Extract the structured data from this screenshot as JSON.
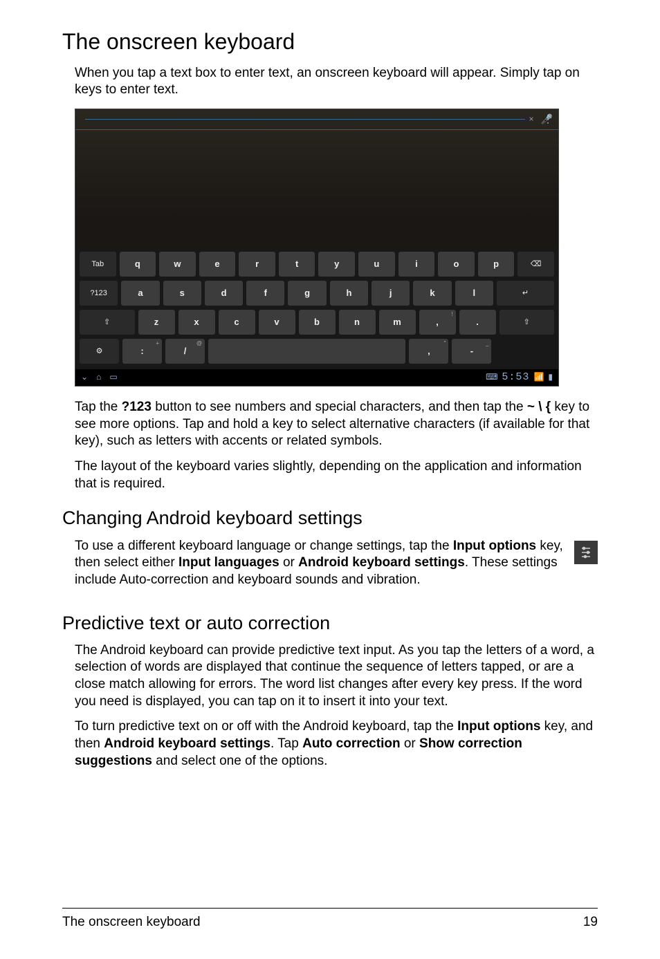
{
  "title": "The onscreen keyboard",
  "intro": "When you tap a text box to enter text, an onscreen keyboard will appear. Simply tap on keys to enter text.",
  "screenshot": {
    "searchbar": {
      "close": "×",
      "mic": "🎤",
      "menu": "⋮"
    },
    "keyboard": {
      "row1": {
        "left": "Tab",
        "keys": [
          "q",
          "w",
          "e",
          "r",
          "t",
          "y",
          "u",
          "i",
          "o",
          "p"
        ],
        "right_icon": "⌫"
      },
      "row2": {
        "left": "?123",
        "keys": [
          "a",
          "s",
          "d",
          "f",
          "g",
          "h",
          "j",
          "k",
          "l"
        ],
        "right_icon": "↵"
      },
      "row3": {
        "left_icon": "⇧",
        "keys": [
          "z",
          "x",
          "c",
          "v",
          "b",
          "n",
          "m",
          ",",
          "."
        ],
        "sup": {
          ",": "!",
          ".": "?"
        },
        "right_icon": "⇧"
      },
      "row4": {
        "settings_icon": "⚙",
        "k1": ":",
        "k1_sup": "+",
        "k2": "/",
        "k2_sup": "@",
        "k3": ",",
        "k3_sup": "\"",
        "k4": "-",
        "k4_sup": "_"
      }
    },
    "sysbar": {
      "back_icon": "⌄",
      "home_icon": "⌂",
      "recent_icon": "▭",
      "kb_icon": "⌨",
      "clock": "5:53",
      "wifi_icon": "📶",
      "batt_icon": "▮"
    }
  },
  "para2": {
    "pre": "Tap the ",
    "b1": "?123",
    "mid1": " button to see numbers and special characters, and then tap the ",
    "b2": "~ \\ {",
    "mid2": " key to see more options. Tap and hold a key to select alternative characters (if available for that key), such as letters with accents or related symbols."
  },
  "para3": "The layout of the keyboard varies slightly, depending on the application and information that is required.",
  "heading2": "Changing Android keyboard settings",
  "para4": {
    "pre": "To use a different keyboard language or change settings, tap the ",
    "b1": "Input options",
    "mid1": " key, then select either ",
    "b2": "Input languages",
    "mid2": " or ",
    "b3": "Android keyboard settings",
    "post": ". These settings include Auto-correction and keyboard sounds and vibration."
  },
  "settings_icon_glyph": "⛻",
  "heading3": "Predictive text or auto correction",
  "para5": "The Android keyboard can provide predictive text input. As you tap the letters of a word, a selection of words are displayed that continue the sequence of letters tapped, or are a close match allowing for errors. The word list changes after every key press. If the word you need is displayed, you can tap on it to insert it into your text.",
  "para6": {
    "pre": "To turn predictive text on or off with the Android keyboard, tap the ",
    "b1": "Input options",
    "mid1": " key, and then ",
    "b2": "Android keyboard settings",
    "mid2": ". Tap ",
    "b3": "Auto correction",
    "mid3": " or ",
    "b4": "Show correction suggestions",
    "post": " and select one of the options."
  },
  "footer": {
    "left": "The onscreen keyboard",
    "right": "19"
  }
}
